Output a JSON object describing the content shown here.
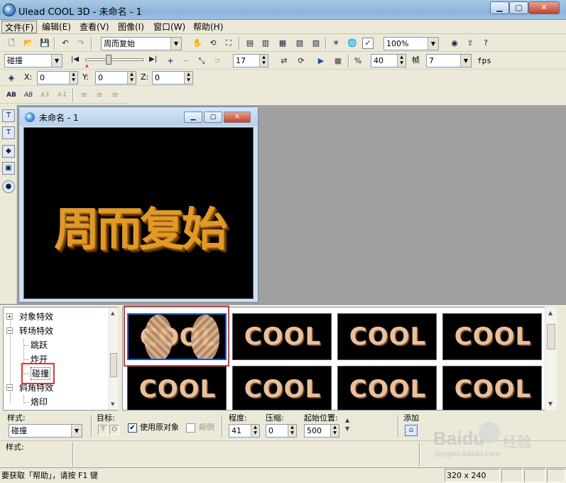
{
  "window": {
    "title": "Ulead COOL 3D - 未命名 - 1"
  },
  "menus": [
    "文件(F)",
    "编辑(E)",
    "查看(V)",
    "图像(I)",
    "窗口(W)",
    "帮助(H)"
  ],
  "toolbar1": {
    "text_combo": "周而复始",
    "zoom_combo": "100%"
  },
  "toolbar2": {
    "effect_combo": "碰撞",
    "frame_spin": "17",
    "frames_total": "40",
    "frames_label": "帧",
    "fps_combo": "7",
    "fps_label": "fps"
  },
  "toolbar3": {
    "x_label": "X:",
    "x_value": "0",
    "y_label": "Y:",
    "y_value": "0",
    "z_label": "Z:",
    "z_value": "0"
  },
  "document": {
    "title": "未命名 - 1",
    "canvas_text": "周而复始"
  },
  "tree": {
    "items": [
      {
        "label": "对象特效",
        "level": 0,
        "expander": "+"
      },
      {
        "label": "转场特效",
        "level": 0,
        "expander": "-"
      },
      {
        "label": "跳跃",
        "level": 1
      },
      {
        "label": "炸开",
        "level": 1
      },
      {
        "label": "碰撞",
        "level": 1,
        "selected": true
      },
      {
        "label": "斜角特效",
        "level": 0,
        "expander": "-"
      },
      {
        "label": "烙印",
        "level": 1
      }
    ]
  },
  "thumbnails": {
    "items": [
      "COOL",
      "COOL",
      "COOL",
      "COOL",
      "COOL",
      "COOL",
      "COOL",
      "COOL"
    ]
  },
  "props": {
    "style_label": "样式:",
    "style_value": "碰撞",
    "target_label": "目标:",
    "target_t": "T",
    "target_o": "O",
    "use_original_label": "使用原对象",
    "use_original_checked": true,
    "reverse_label": "颠倒",
    "reverse_checked": false,
    "degree_label": "程度:",
    "degree_value": "41",
    "compress_label": "压缩:",
    "compress_value": "0",
    "start_label": "起始位置:",
    "start_value": "500",
    "add_label": "添加"
  },
  "notes": {
    "label": "样式:"
  },
  "status": {
    "hint": "要获取「帮助」，请按 F1 键",
    "size": "320 x 240"
  },
  "watermark": {
    "brand": "Baidu",
    "brand_cn": "经验",
    "url": "jingyan.baidu.com"
  }
}
